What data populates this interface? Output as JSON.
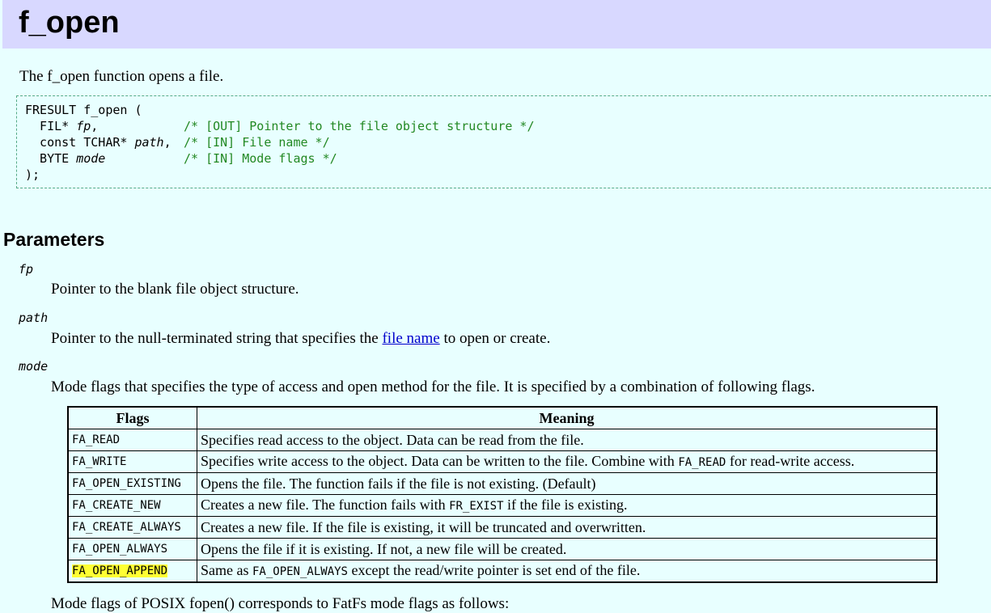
{
  "title": "f_open",
  "intro": "The f_open function opens a file.",
  "code": {
    "line1": "FRESULT f_open (",
    "p1_pre": "  FIL* ",
    "p1_name": "fp",
    "p1_post": ",",
    "p1_comment": "/* [OUT] Pointer to the file object structure */",
    "p2_pre": "  const TCHAR* ",
    "p2_name": "path",
    "p2_post": ",",
    "p2_comment": "/* [IN] File name */",
    "p3_pre": "  BYTE ",
    "p3_name": "mode",
    "p3_comment": "/* [IN] Mode flags */",
    "line_end": ");"
  },
  "parameters": {
    "heading": "Parameters",
    "fp": {
      "name": "fp",
      "desc": "Pointer to the blank file object structure."
    },
    "path": {
      "name": "path",
      "desc_pre": "Pointer to the null-terminated string that specifies the ",
      "link": "file name",
      "desc_post": " to open or create."
    },
    "mode": {
      "name": "mode",
      "desc": "Mode flags that specifies the type of access and open method for the file. It is specified by a combination of following flags."
    }
  },
  "table": {
    "headers": [
      "Flags",
      "Meaning"
    ],
    "rows": [
      {
        "flag": "FA_READ",
        "meaning": "Specifies read access to the object. Data can be read from the file."
      },
      {
        "flag": "FA_WRITE",
        "meaning_pre": "Specifies write access to the object. Data can be written to the file. Combine with ",
        "meaning_code": "FA_READ",
        "meaning_post": " for read-write access."
      },
      {
        "flag": "FA_OPEN_EXISTING",
        "meaning": "Opens the file. The function fails if the file is not existing. (Default)"
      },
      {
        "flag": "FA_CREATE_NEW",
        "meaning_pre": "Creates a new file. The function fails with ",
        "meaning_code": "FR_EXIST",
        "meaning_post": " if the file is existing."
      },
      {
        "flag": "FA_CREATE_ALWAYS",
        "meaning": "Creates a new file. If the file is existing, it will be truncated and overwritten."
      },
      {
        "flag": "FA_OPEN_ALWAYS",
        "meaning": "Opens the file if it is existing. If not, a new file will be created."
      },
      {
        "flag": "FA_OPEN_APPEND",
        "meaning_pre": "Same as ",
        "meaning_code": "FA_OPEN_ALWAYS",
        "meaning_post": " except the read/write pointer is set end of the file."
      }
    ]
  },
  "partial_text": "Mode flags of POSIX fopen() corresponds to FatFs mode flags as follows:",
  "colors": {
    "title_bg": "#d8d8ff",
    "page_bg": "#e8ffff",
    "comment": "#228822",
    "highlight": "#ffff33",
    "link": "#0000cc"
  }
}
